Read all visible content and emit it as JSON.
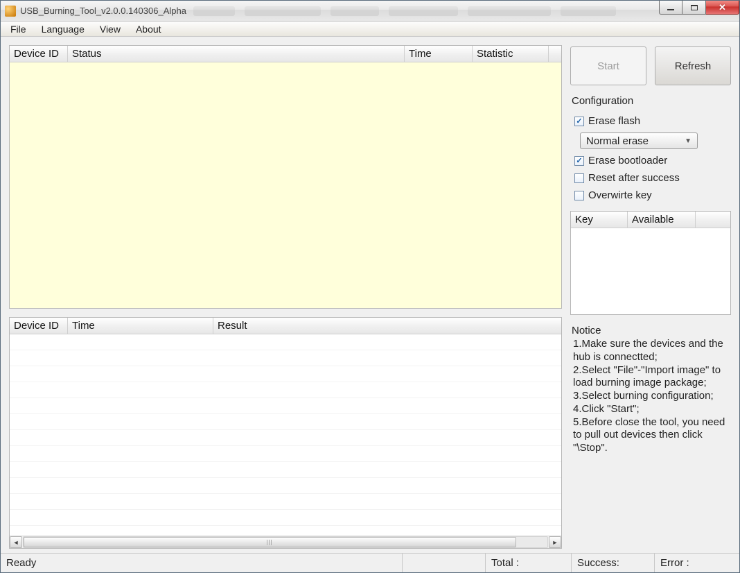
{
  "window": {
    "title": "USB_Burning_Tool_v2.0.0.140306_Alpha"
  },
  "menu": {
    "file": "File",
    "language": "Language",
    "view": "View",
    "about": "About"
  },
  "table_top": {
    "headers": {
      "device_id": "Device ID",
      "status": "Status",
      "time": "Time",
      "statistic": "Statistic"
    }
  },
  "table_bottom": {
    "headers": {
      "device_id": "Device ID",
      "time": "Time",
      "result": "Result"
    }
  },
  "buttons": {
    "start": "Start",
    "refresh": "Refresh"
  },
  "config": {
    "title": "Configuration",
    "erase_flash": {
      "label": "Erase flash",
      "checked": true
    },
    "erase_mode": {
      "selected": "Normal erase"
    },
    "erase_bootloader": {
      "label": "Erase bootloader",
      "checked": true
    },
    "reset_after_success": {
      "label": "Reset after success",
      "checked": false
    },
    "overwrite_key": {
      "label": "Overwirte key",
      "checked": false
    }
  },
  "key_table": {
    "headers": {
      "key": "Key",
      "available": "Available"
    }
  },
  "notice": {
    "title": "Notice",
    "line1": "1.Make sure the devices and the hub is connectted;",
    "line2": "2.Select \"File\"-\"Import image\" to load burning image package;",
    "line3": "3.Select burning configuration;",
    "line4": "4.Click \"Start\";",
    "line5": "5.Before close the tool, you need to pull out devices then click \"\\Stop\"."
  },
  "status": {
    "ready": "Ready",
    "total": "Total :",
    "success": "Success:",
    "error": "Error :"
  }
}
